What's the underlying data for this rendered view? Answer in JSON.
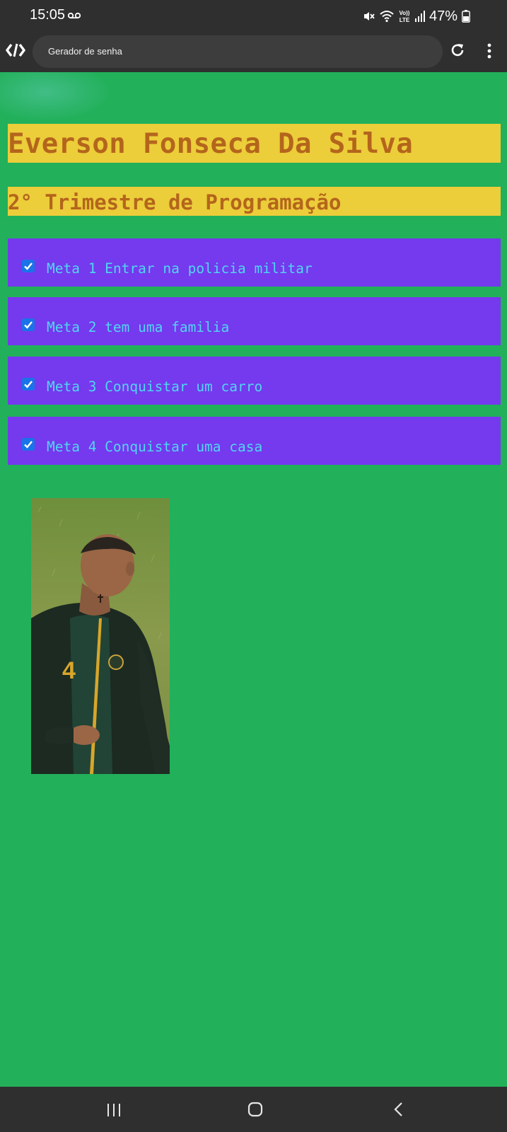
{
  "status_bar": {
    "time": "15:05",
    "battery": "47%",
    "icons": [
      "voicemail-icon",
      "mute-icon",
      "wifi-icon",
      "volte-icon",
      "signal-icon",
      "battery-icon"
    ]
  },
  "browser": {
    "url_text": "Gerador de senha",
    "icons": [
      "app-logo-icon",
      "reload-icon",
      "more-menu-icon"
    ]
  },
  "page": {
    "title": "Everson Fonseca Da Silva",
    "subtitle": "2° Trimestre de Programação",
    "goals": [
      {
        "label": "Meta 1 Entrar na policia militar",
        "checked": true
      },
      {
        "label": "Meta 2 tem uma familia",
        "checked": true
      },
      {
        "label": "Meta 3 Conquistar um carro",
        "checked": true
      },
      {
        "label": "Meta 4 Conquistar uma casa",
        "checked": true
      }
    ],
    "image": "player-photo"
  },
  "colors": {
    "page_background": "#22b05a",
    "title_background": "#eccd3a",
    "title_text": "#b4651c",
    "goal_background": "#7539ee",
    "goal_text": "#4fd7f2",
    "checkbox": "#1a73e8",
    "system_bars": "#2f2f2f"
  },
  "nav_bar": {
    "icons": [
      "recents-icon",
      "home-icon",
      "back-icon"
    ]
  }
}
